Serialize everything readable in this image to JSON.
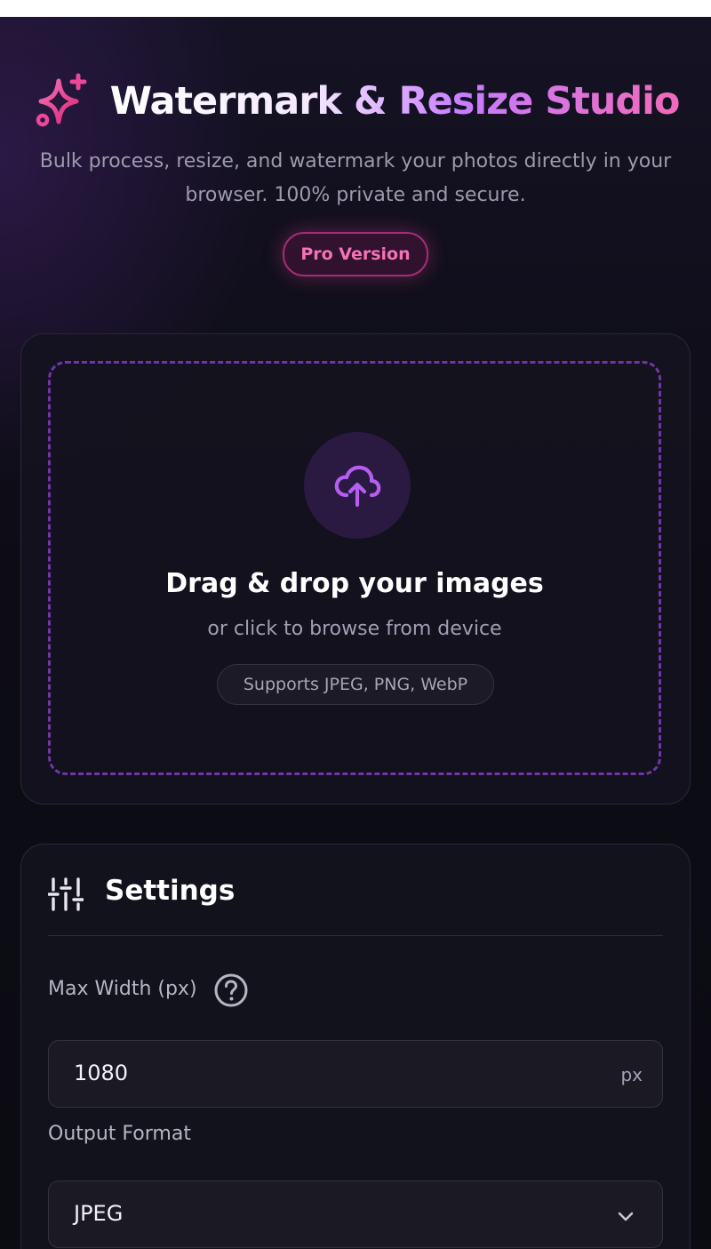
{
  "header": {
    "title": "Watermark & Resize Studio",
    "subtitle": "Bulk process, resize, and watermark your photos directly in your browser. 100% private and secure.",
    "badge": "Pro Version",
    "logo_icon": "sparkles-icon"
  },
  "upload": {
    "icon": "cloud-upload-icon",
    "title": "Drag & drop your images",
    "subtitle": "or click to browse from device",
    "formats": "Supports JPEG, PNG, WebP"
  },
  "settings": {
    "icon": "sliders-icon",
    "title": "Settings",
    "max_width": {
      "label": "Max Width (px)",
      "help_icon": "help-circle-icon",
      "value": "1080",
      "unit": "px"
    },
    "output_format": {
      "label": "Output Format",
      "value": "JPEG",
      "icon": "chevron-down-icon"
    }
  },
  "colors": {
    "background": "#0d0c15",
    "accent_purple": "#a855f7",
    "accent_pink": "#ec4899",
    "card_border": "#2a2838"
  }
}
